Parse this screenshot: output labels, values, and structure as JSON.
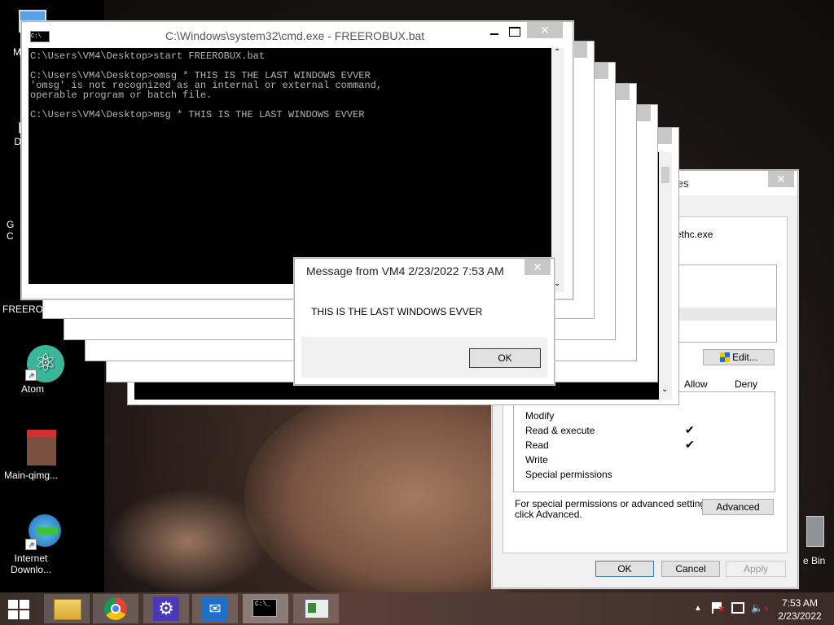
{
  "desktop": {
    "icons": [
      {
        "label": "My C",
        "icon": "computer-icon"
      },
      {
        "label": "Data",
        "icon": "data-icon"
      },
      {
        "label": "G\nC",
        "icon": "chrome-icon"
      },
      {
        "label": "FREEROB",
        "icon": "batch-file-icon"
      },
      {
        "label": "Atom",
        "icon": "atom-icon"
      },
      {
        "label": "Main-qimg...",
        "icon": "image-icon"
      },
      {
        "label": "Internet\nDownlo...",
        "icon": "idm-icon"
      },
      {
        "label": "e Bin",
        "icon": "recycle-bin-icon"
      }
    ]
  },
  "cmd": {
    "title": "C:\\Windows\\system32\\cmd.exe - FREEROBUX.bat",
    "lines": "C:\\Users\\VM4\\Desktop>start FREEROBUX.bat\n\nC:\\Users\\VM4\\Desktop>omsg * THIS IS THE LAST WINDOWS EVVER\n'omsg' is not recognized as an internal or external command,\noperable program or batch file.\n\nC:\\Users\\VM4\\Desktop>msg * THIS IS THE LAST WINDOWS EVVER",
    "title_icon": "console-icon"
  },
  "message": {
    "title": "Message from VM4 2/23/2022 7:53 AM",
    "body": "THIS IS THE LAST WINDOWS EVVER",
    "ok": "OK"
  },
  "props": {
    "title_partial": "es",
    "object_partial": "ethc.exe",
    "edit": "Edit...",
    "allow": "Allow",
    "deny": "Deny",
    "permissions": [
      {
        "name": "Modify",
        "allow": ""
      },
      {
        "name": "Read & execute",
        "allow": "✔"
      },
      {
        "name": "Read",
        "allow": "✔"
      },
      {
        "name": "Write",
        "allow": ""
      },
      {
        "name": "Special permissions",
        "allow": ""
      }
    ],
    "advanced_text": "For special permissions or advanced settings,\nclick Advanced.",
    "advanced": "Advanced",
    "ok": "OK",
    "cancel": "Cancel",
    "apply": "Apply"
  },
  "taskbar": {
    "items": [
      "file-explorer-icon",
      "chrome-icon",
      "settings-icon",
      "mail-icon",
      "cmd-icon",
      "control-panel-icon"
    ],
    "time": "7:53 AM",
    "date": "2/23/2022"
  }
}
